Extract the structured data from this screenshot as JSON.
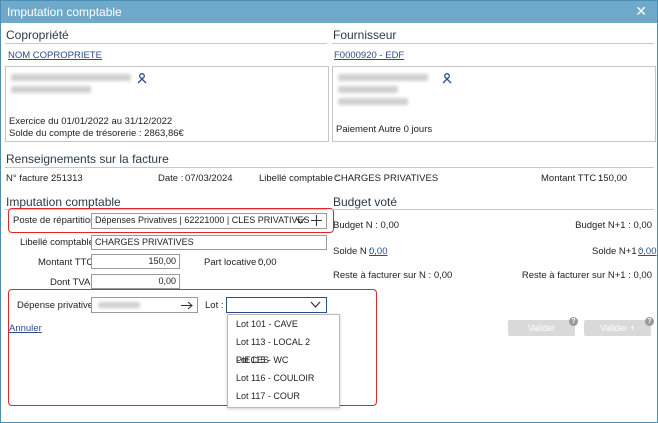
{
  "window": {
    "title": "Imputation comptable",
    "close_label": "✕"
  },
  "copropriete": {
    "heading": "Copropriété",
    "name_link": "NOM COPROPRIETE",
    "exercice": "Exercice du 01/01/2022 au 31/12/2022",
    "solde": "Solde du compte de trésorerie : 2863,86€"
  },
  "fournisseur": {
    "heading": "Fournisseur",
    "link": "F0000920 - EDF",
    "paiement": "Paiement Autre 0 jours"
  },
  "facture": {
    "heading": "Renseignements sur la facture",
    "numero_label": "N° facture :",
    "numero_value": "251313",
    "date_label": "Date :",
    "date_value": "07/03/2024",
    "libelle_label": "Libellé comptable :",
    "libelle_value": "CHARGES PRIVATIVES",
    "montant_label": "Montant TTC :",
    "montant_value": "150,00"
  },
  "imputation": {
    "heading": "Imputation comptable",
    "poste_label": "Poste de répartition :",
    "poste_value": "Dépenses Privatives | 62221000 | CLES PRIVATIVES",
    "libelle_label": "Libellé comptable :",
    "libelle_value": "CHARGES PRIVATIVES",
    "montant_label": "Montant TTC :",
    "montant_value": "150,00",
    "part_label": "Part locative :",
    "part_value": "0,00",
    "tva_label": "Dont TVA :",
    "tva_value": "0,00",
    "depense_label": "Dépense privative :",
    "lot_label": "Lot :",
    "annuler": "Annuler"
  },
  "lots": [
    "Lot 101 - CAVE",
    "Lot 113 - LOCAL 2 PIECES",
    "Lot 115 - WC",
    "Lot 116 - COULOIR",
    "Lot 117 - COUR"
  ],
  "budget": {
    "heading": "Budget voté",
    "budget_n": "Budget N : 0,00",
    "budget_n1": "Budget N+1 : 0,00",
    "solde_n_label": "Solde N :",
    "solde_n_value": "0,00",
    "solde_n1_label": "Solde N+1 :",
    "solde_n1_value": "0,00",
    "reste_n": "Reste à facturer sur N : 0,00",
    "reste_n1": "Reste à facturer sur N+1 : 0,00"
  },
  "buttons": {
    "valider": "Valider",
    "valider_plus": "Valider +",
    "help": "?"
  },
  "colors": {
    "titlebar": "#6fa9c9",
    "highlight": "#e0262b",
    "link": "#2a4d8c"
  }
}
